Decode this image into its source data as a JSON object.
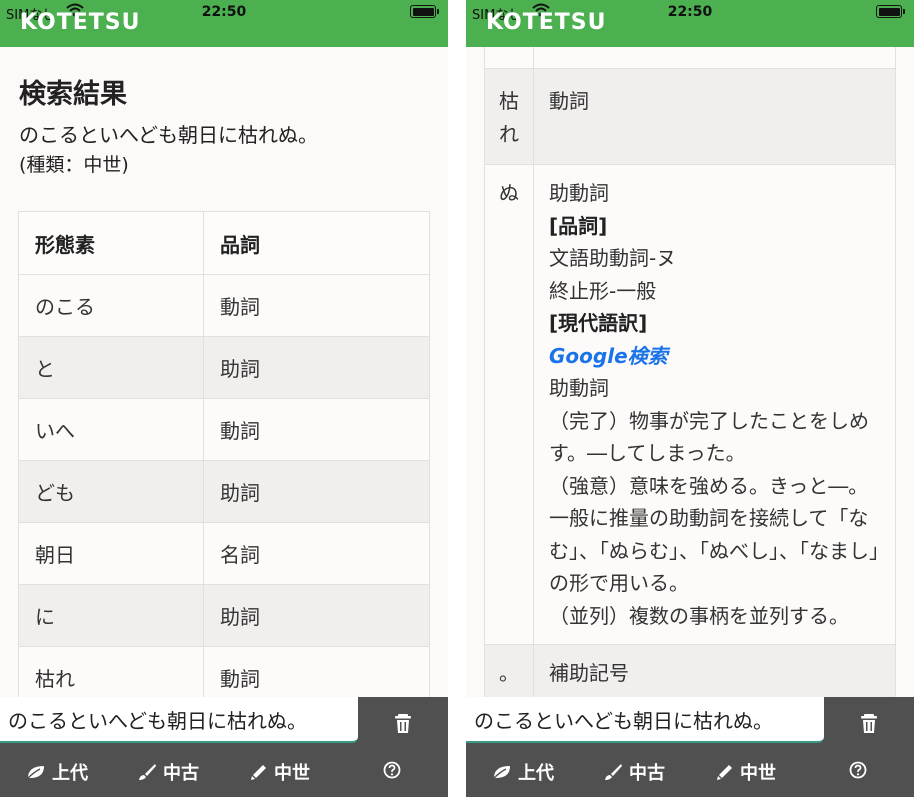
{
  "status": {
    "carrier": "SIMなし",
    "time": "22:50"
  },
  "app": {
    "name": "KOTETSU"
  },
  "search": {
    "title": "検索結果",
    "query": "のこるといへども朝日に枯れぬ。",
    "type_label": "(種類：中世)"
  },
  "table": {
    "headers": [
      "形態素",
      "品詞"
    ],
    "rows": [
      [
        "のこる",
        "動詞"
      ],
      [
        "と",
        "助詞"
      ],
      [
        "いへ",
        "動詞"
      ],
      [
        "ども",
        "助詞"
      ],
      [
        "朝日",
        "名詞"
      ],
      [
        "に",
        "助詞"
      ],
      [
        "枯れ",
        "動詞"
      ]
    ]
  },
  "detail": {
    "row_kare": {
      "word": "枯れ",
      "pos": "動詞"
    },
    "row_nu": {
      "word": "ぬ",
      "pos": "助動詞",
      "pos_heading": "[品詞]",
      "pos_line1": "文語助動詞-ヌ",
      "pos_line2": "終止形-一般",
      "trans_heading": "[現代語訳]",
      "google_link": "Google検索",
      "def_pos": "助動詞",
      "def1": "（完了）物事が完了したことをしめす。―してしまった。",
      "def2": "（強意）意味を強める。きっと―。一般に推量の助動詞を接続して「なむ」、「ぬらむ」、「ぬべし」、「なまし」の形で用いる。",
      "def3": "（並列）複数の事柄を並列する。"
    },
    "row_period": {
      "word": "。",
      "pos": "補助記号"
    }
  },
  "input": {
    "value": "のこるといへども朝日に枯れぬ。"
  },
  "nav": {
    "jodai": "上代",
    "chuko": "中古",
    "chusei": "中世"
  },
  "icons": {
    "wifi": "wifi-icon",
    "battery": "battery-icon",
    "trash": "trash-icon",
    "leaf": "leaf-icon",
    "brush": "brush-icon",
    "pencil": "pencil-icon",
    "help": "help-icon"
  },
  "colors": {
    "appbar": "#4caf50",
    "bottombar": "#505050",
    "link": "#1a73e8",
    "accent_line": "#3a9a8a"
  }
}
